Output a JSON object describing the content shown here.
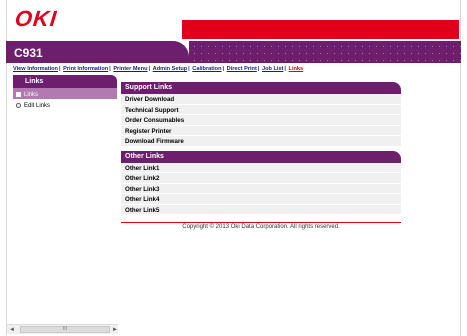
{
  "brand": {
    "logo_text": "OKI",
    "accent": "#e0001a",
    "primary": "#6d1f6e"
  },
  "header": {
    "model": "C931"
  },
  "nav": {
    "items": [
      {
        "label": "View Information",
        "active": false
      },
      {
        "label": "Print Information",
        "active": false
      },
      {
        "label": "Printer Menu",
        "active": false
      },
      {
        "label": "Admin Setup",
        "active": false
      },
      {
        "label": "Calibration",
        "active": false
      },
      {
        "label": "Direct Print",
        "active": false
      },
      {
        "label": "Job List",
        "active": false
      },
      {
        "label": "Links",
        "active": true
      }
    ],
    "separator": "|"
  },
  "sidebar": {
    "title": "Links",
    "items": [
      {
        "label": "Links",
        "active": true
      },
      {
        "label": "Edit Links",
        "active": false
      }
    ]
  },
  "sections": [
    {
      "title": "Support Links",
      "links": [
        "Driver Download",
        "Technical Support",
        "Order Consumables",
        "Register Printer",
        "Download Firmware"
      ]
    },
    {
      "title": "Other Links",
      "links": [
        "Other Link1",
        "Other Link2",
        "Other Link3",
        "Other Link4",
        "Other Link5"
      ]
    }
  ],
  "footer": {
    "copyright": "Copyright © 2013 Oki Data Corporation. All rights reserved."
  },
  "scrollbar": {
    "left_arrow": "◄",
    "right_arrow": "►",
    "grip": "III"
  }
}
